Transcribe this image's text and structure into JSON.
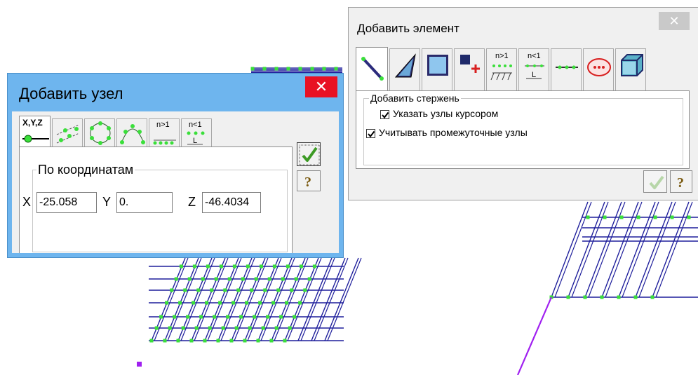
{
  "dialog_node": {
    "title": "Добавить узел",
    "close_icon": "close-icon",
    "tabs": [
      {
        "label": "X,Y,Z",
        "icon": "node-xyz-icon",
        "active": true
      },
      {
        "label": "",
        "icon": "node-divide-line-icon"
      },
      {
        "label": "",
        "icon": "node-circle-icon"
      },
      {
        "label": "",
        "icon": "node-arc-icon"
      },
      {
        "label": "n>1",
        "icon": "node-divide-n-icon"
      },
      {
        "label": "n<1",
        "icon": "node-divide-l-icon"
      }
    ],
    "group_label": "По координатам",
    "fields": {
      "x_label": "X",
      "x_value": "-25.058",
      "y_label": "Y",
      "y_value": "0.",
      "z_label": "Z",
      "z_value": "-46.4034"
    },
    "apply_icon": "checkmark-icon",
    "help_icon": "question-icon"
  },
  "dialog_element": {
    "title": "Добавить элемент",
    "close_icon": "close-icon",
    "tabs": [
      {
        "icon": "bar-element-icon",
        "active": true
      },
      {
        "icon": "triangle-plate-icon"
      },
      {
        "icon": "quad-plate-icon"
      },
      {
        "icon": "single-node-element-icon"
      },
      {
        "label": "n>1",
        "icon": "divide-n-icon"
      },
      {
        "label": "n<1",
        "icon": "divide-l-icon"
      },
      {
        "icon": "chain-element-icon"
      },
      {
        "icon": "contour-element-icon"
      },
      {
        "icon": "solid-element-icon"
      }
    ],
    "group_label": "Добавить стержень",
    "checkboxes": [
      {
        "label": "Указать узлы курсором",
        "checked": true
      },
      {
        "label": "Учитывать промежуточные узлы",
        "checked": true
      }
    ],
    "apply_icon": "checkmark-disabled-icon",
    "help_icon": "question-icon"
  },
  "colors": {
    "mesh": "#1f1f9c",
    "node": "#3adf3a",
    "highlight": "#a020f0",
    "titlebar_node": "#6eb5ee",
    "titlebar_element": "#f0f0f0",
    "close_red": "#e81123",
    "close_gray": "#c9c9c9"
  }
}
